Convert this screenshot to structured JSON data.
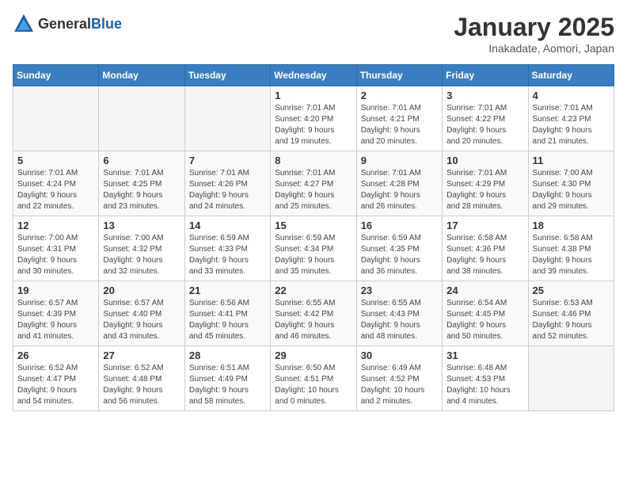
{
  "logo": {
    "general": "General",
    "blue": "Blue"
  },
  "header": {
    "month": "January 2025",
    "location": "Inakadate, Aomori, Japan"
  },
  "weekdays": [
    "Sunday",
    "Monday",
    "Tuesday",
    "Wednesday",
    "Thursday",
    "Friday",
    "Saturday"
  ],
  "weeks": [
    [
      {
        "day": "",
        "info": ""
      },
      {
        "day": "",
        "info": ""
      },
      {
        "day": "",
        "info": ""
      },
      {
        "day": "1",
        "info": "Sunrise: 7:01 AM\nSunset: 4:20 PM\nDaylight: 9 hours\nand 19 minutes."
      },
      {
        "day": "2",
        "info": "Sunrise: 7:01 AM\nSunset: 4:21 PM\nDaylight: 9 hours\nand 20 minutes."
      },
      {
        "day": "3",
        "info": "Sunrise: 7:01 AM\nSunset: 4:22 PM\nDaylight: 9 hours\nand 20 minutes."
      },
      {
        "day": "4",
        "info": "Sunrise: 7:01 AM\nSunset: 4:23 PM\nDaylight: 9 hours\nand 21 minutes."
      }
    ],
    [
      {
        "day": "5",
        "info": "Sunrise: 7:01 AM\nSunset: 4:24 PM\nDaylight: 9 hours\nand 22 minutes."
      },
      {
        "day": "6",
        "info": "Sunrise: 7:01 AM\nSunset: 4:25 PM\nDaylight: 9 hours\nand 23 minutes."
      },
      {
        "day": "7",
        "info": "Sunrise: 7:01 AM\nSunset: 4:26 PM\nDaylight: 9 hours\nand 24 minutes."
      },
      {
        "day": "8",
        "info": "Sunrise: 7:01 AM\nSunset: 4:27 PM\nDaylight: 9 hours\nand 25 minutes."
      },
      {
        "day": "9",
        "info": "Sunrise: 7:01 AM\nSunset: 4:28 PM\nDaylight: 9 hours\nand 26 minutes."
      },
      {
        "day": "10",
        "info": "Sunrise: 7:01 AM\nSunset: 4:29 PM\nDaylight: 9 hours\nand 28 minutes."
      },
      {
        "day": "11",
        "info": "Sunrise: 7:00 AM\nSunset: 4:30 PM\nDaylight: 9 hours\nand 29 minutes."
      }
    ],
    [
      {
        "day": "12",
        "info": "Sunrise: 7:00 AM\nSunset: 4:31 PM\nDaylight: 9 hours\nand 30 minutes."
      },
      {
        "day": "13",
        "info": "Sunrise: 7:00 AM\nSunset: 4:32 PM\nDaylight: 9 hours\nand 32 minutes."
      },
      {
        "day": "14",
        "info": "Sunrise: 6:59 AM\nSunset: 4:33 PM\nDaylight: 9 hours\nand 33 minutes."
      },
      {
        "day": "15",
        "info": "Sunrise: 6:59 AM\nSunset: 4:34 PM\nDaylight: 9 hours\nand 35 minutes."
      },
      {
        "day": "16",
        "info": "Sunrise: 6:59 AM\nSunset: 4:35 PM\nDaylight: 9 hours\nand 36 minutes."
      },
      {
        "day": "17",
        "info": "Sunrise: 6:58 AM\nSunset: 4:36 PM\nDaylight: 9 hours\nand 38 minutes."
      },
      {
        "day": "18",
        "info": "Sunrise: 6:58 AM\nSunset: 4:38 PM\nDaylight: 9 hours\nand 39 minutes."
      }
    ],
    [
      {
        "day": "19",
        "info": "Sunrise: 6:57 AM\nSunset: 4:39 PM\nDaylight: 9 hours\nand 41 minutes."
      },
      {
        "day": "20",
        "info": "Sunrise: 6:57 AM\nSunset: 4:40 PM\nDaylight: 9 hours\nand 43 minutes."
      },
      {
        "day": "21",
        "info": "Sunrise: 6:56 AM\nSunset: 4:41 PM\nDaylight: 9 hours\nand 45 minutes."
      },
      {
        "day": "22",
        "info": "Sunrise: 6:55 AM\nSunset: 4:42 PM\nDaylight: 9 hours\nand 46 minutes."
      },
      {
        "day": "23",
        "info": "Sunrise: 6:55 AM\nSunset: 4:43 PM\nDaylight: 9 hours\nand 48 minutes."
      },
      {
        "day": "24",
        "info": "Sunrise: 6:54 AM\nSunset: 4:45 PM\nDaylight: 9 hours\nand 50 minutes."
      },
      {
        "day": "25",
        "info": "Sunrise: 6:53 AM\nSunset: 4:46 PM\nDaylight: 9 hours\nand 52 minutes."
      }
    ],
    [
      {
        "day": "26",
        "info": "Sunrise: 6:52 AM\nSunset: 4:47 PM\nDaylight: 9 hours\nand 54 minutes."
      },
      {
        "day": "27",
        "info": "Sunrise: 6:52 AM\nSunset: 4:48 PM\nDaylight: 9 hours\nand 56 minutes."
      },
      {
        "day": "28",
        "info": "Sunrise: 6:51 AM\nSunset: 4:49 PM\nDaylight: 9 hours\nand 58 minutes."
      },
      {
        "day": "29",
        "info": "Sunrise: 6:50 AM\nSunset: 4:51 PM\nDaylight: 10 hours\nand 0 minutes."
      },
      {
        "day": "30",
        "info": "Sunrise: 6:49 AM\nSunset: 4:52 PM\nDaylight: 10 hours\nand 2 minutes."
      },
      {
        "day": "31",
        "info": "Sunrise: 6:48 AM\nSunset: 4:53 PM\nDaylight: 10 hours\nand 4 minutes."
      },
      {
        "day": "",
        "info": ""
      }
    ]
  ]
}
